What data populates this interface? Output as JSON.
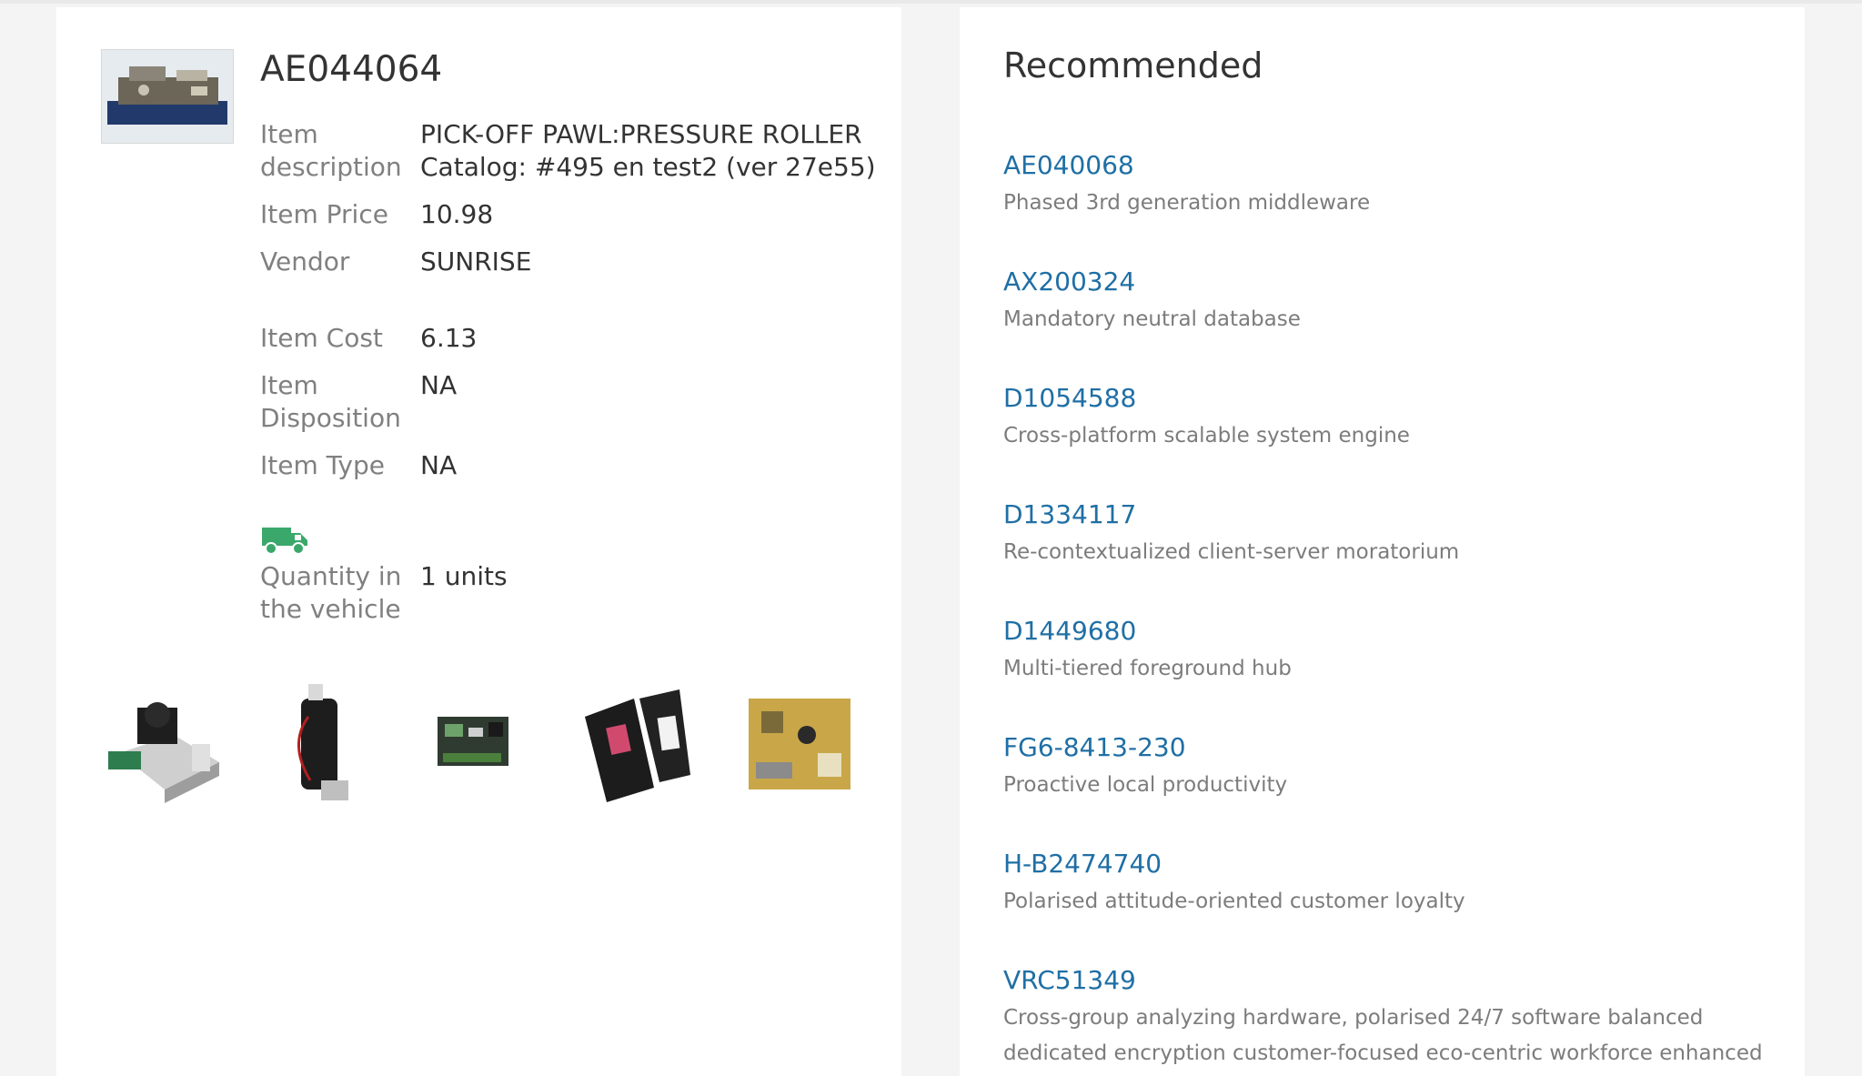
{
  "item": {
    "title": "AE044064",
    "fields": [
      {
        "label": "Item description",
        "value": "PICK-OFF PAWL:PRESSURE ROLLER Catalog: #495 en test2 (ver 27e55)"
      },
      {
        "label": "Item Price",
        "value": "10.98"
      },
      {
        "label": "Vendor",
        "value": "SUNRISE"
      },
      {
        "label": "Item Cost",
        "value": "6.13"
      },
      {
        "label": "Item Disposition",
        "value": "NA"
      },
      {
        "label": "Item Type",
        "value": "NA"
      }
    ],
    "vehicle": {
      "icon": "van-icon",
      "label": "Quantity in the vehicle",
      "value": "1  units"
    },
    "related_thumbnails": [
      "print-head-thumbnail",
      "motor-thumbnail",
      "circuit-board-thumbnail",
      "card-tray-thumbnail",
      "power-board-thumbnail"
    ]
  },
  "recommended": {
    "heading": "Recommended",
    "items": [
      {
        "code": "AE040068",
        "description": "Phased 3rd generation middleware"
      },
      {
        "code": "AX200324",
        "description": "Mandatory neutral database"
      },
      {
        "code": "D1054588",
        "description": "Cross-platform scalable system engine"
      },
      {
        "code": "D1334117",
        "description": "Re-contextualized client-server moratorium"
      },
      {
        "code": "D1449680",
        "description": "Multi-tiered foreground hub"
      },
      {
        "code": "FG6-8413-230",
        "description": "Proactive local productivity"
      },
      {
        "code": "H-B2474740",
        "description": "Polarised attitude-oriented customer loyalty"
      },
      {
        "code": "VRC51349",
        "description": "Cross-group analyzing hardware, polarised 24/7 software balanced dedicated encryption customer-focused eco-centric workforce enhanced"
      }
    ]
  },
  "colors": {
    "link": "#1f6fa5",
    "van": "#3aa86b",
    "label": "#808080",
    "value": "#333333"
  }
}
